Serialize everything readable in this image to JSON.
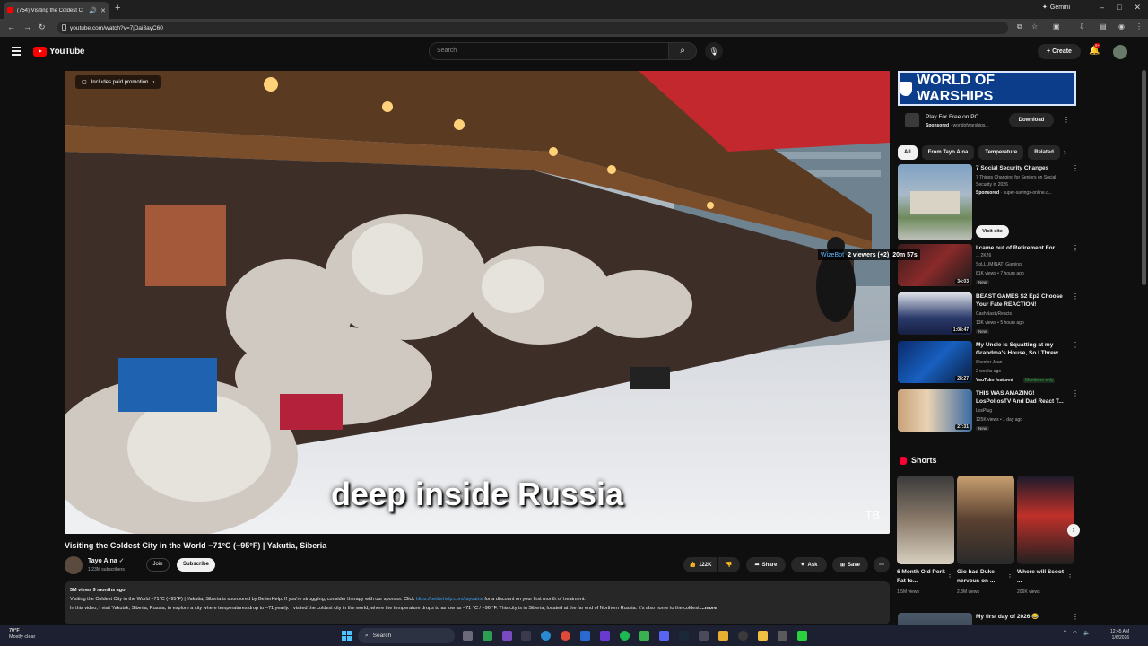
{
  "browser": {
    "tab_title": "(754) Visiting the Coldest C",
    "url": "youtube.com/watch?v=7jDai3ayC60",
    "gemini_label": "Gemini",
    "window_controls": [
      "–",
      "□",
      "✕"
    ]
  },
  "header": {
    "logo_text": "YouTube",
    "search_placeholder": "Search",
    "create_label": "Create",
    "notification_badge": "9+"
  },
  "video": {
    "promo_label": "Includes paid promotion",
    "caption": "deep inside Russia",
    "watermark": "TB",
    "title": "Visiting the Coldest City in the World −71°C (−95°F) | Yakutia, Siberia",
    "channel": {
      "name": "Tayo Aina",
      "subscribers": "1.23M subscribers",
      "join_label": "Join",
      "subscribe_label": "Subscribe"
    },
    "actions": {
      "likes": "122K",
      "share": "Share",
      "ask": "Ask",
      "save": "Save"
    },
    "description": {
      "meta": "5M views  9 months ago",
      "line1_text": "Visiting the Coldest City in the World −71°C (−95°F) | Yakutia, Siberia is sponsored by BetterHelp. If you're struggling, consider therapy with our sponsor. Click",
      "line1_link": "https://betterhelp.com/tayoaina",
      "line1_tail": "for a discount on your first month of treatment.",
      "line2_text": "In this video, I visit Yakutsk, Siberia, Russia, to explore a city where temperatures drop to −71 yearly. I visited the coldest city in the world, where the temperature drops to as low as −71 °C / −96 °F. This city is in Siberia, located at the far end of Northern Russia. It's also home to the coldest",
      "more_label": "...more"
    }
  },
  "sidebar": {
    "ad": {
      "banner_text": "WORLD OF WARSHIPS",
      "title": "Play For Free on PC",
      "sponsored": "Sponsored",
      "domain": "worldofwarships...",
      "download_label": "Download"
    },
    "chips": [
      "All",
      "From Tayo Aina",
      "Temperature",
      "Related"
    ],
    "recommendations": [
      {
        "title": "7 Social Security Changes",
        "subtitle": "7 Things Changing for Seniors on Social Security in 2026",
        "sponsored": "Sponsored",
        "domain": "super-savings-online.c...",
        "visit_label": "Visit site"
      },
      {
        "title": "I came out of Retirement For",
        "subtitle": "... 2K26",
        "channel": "SoLLUMINATI Gaming",
        "meta": "81K views • 7 hours ago",
        "tag": "New",
        "duration": "34:03"
      },
      {
        "title": "BEAST GAMES S2 Ep2 Choose Your Fate REACTION!",
        "channel": "CashNastyReacts",
        "meta": "13K views • 5 hours ago",
        "tag": "New",
        "duration": "1:08:47"
      },
      {
        "title": "My Uncle Is Squatting at my Grandma's House, So I Threw ...",
        "channel": "Skeeter Jean",
        "meta": "2 weeks ago",
        "featured": "YouTube featured",
        "members": "Members only",
        "duration": "28:27"
      },
      {
        "title": "THIS WAS AMAZING! LosPollosTV And Dad React T...",
        "channel": "LosPlug",
        "meta": "125K views • 1 day ago",
        "tag": "New",
        "duration": "27:31"
      }
    ],
    "overlay": {
      "name": "WizeBot",
      "viewers": "2 viewers (+2)",
      "timer": "20m 57s"
    },
    "shorts": {
      "heading": "Shorts",
      "items": [
        {
          "title": "6 Month Old Pork Fat fo...",
          "views": "1.5M views"
        },
        {
          "title": "Gio had Duke nervous on ...",
          "views": "2.3M views"
        },
        {
          "title": "Where will Scoot ...",
          "views": "206K views"
        }
      ],
      "next_title": "My first day of 2026 😂"
    }
  },
  "taskbar": {
    "weather_temp": "70°F",
    "weather_desc": "Mostly clear",
    "search_label": "Search",
    "time": "12:45 AM",
    "date": "1/6/2026"
  },
  "colors": {
    "background": "#0f0f0f",
    "youtube_red": "#ff0000",
    "link_blue": "#3ea6ff",
    "taskbar": "#1c2030"
  }
}
